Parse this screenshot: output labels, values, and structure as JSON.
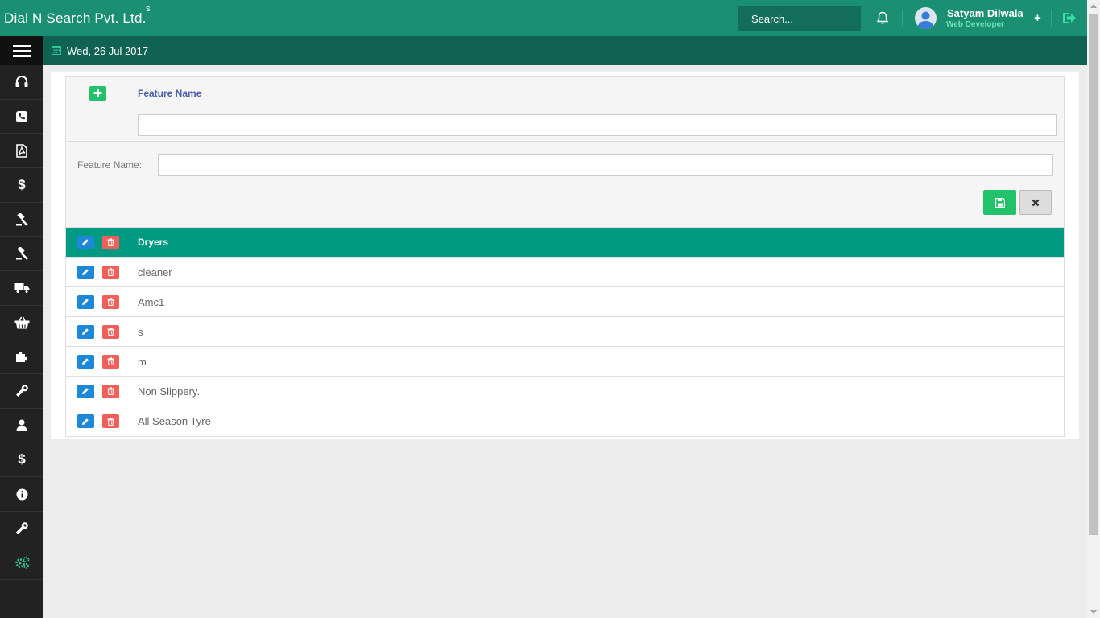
{
  "header": {
    "brand": "Dial N Search Pvt. Ltd.",
    "brand_sup": "s",
    "search_placeholder": "Search...",
    "user_name": "Satyam Dilwala",
    "user_role": "Web Developer",
    "plus_label": "+"
  },
  "subheader": {
    "date": "Wed, 26 Jul 2017"
  },
  "sidebar": {
    "items": [
      {
        "icon": "headset-icon"
      },
      {
        "icon": "phone-icon"
      },
      {
        "icon": "pdf-file-icon"
      },
      {
        "icon": "dollar-icon",
        "glyph": "$"
      },
      {
        "icon": "gavel-icon"
      },
      {
        "icon": "gavel-icon"
      },
      {
        "icon": "truck-icon"
      },
      {
        "icon": "basket-icon"
      },
      {
        "icon": "puzzle-icon"
      },
      {
        "icon": "wrench-icon"
      },
      {
        "icon": "user-icon"
      },
      {
        "icon": "dollar-icon",
        "glyph": "$"
      },
      {
        "icon": "info-icon"
      },
      {
        "icon": "wrench-icon"
      },
      {
        "icon": "gears-icon"
      }
    ]
  },
  "grid": {
    "header_title": "Feature Name",
    "filter_value": "",
    "form": {
      "label": "Feature Name:",
      "value": ""
    },
    "rows": [
      {
        "label": "Dryers",
        "selected": true
      },
      {
        "label": "cleaner"
      },
      {
        "label": "Amc1"
      },
      {
        "label": "s"
      },
      {
        "label": "m"
      },
      {
        "label": "Non Slippery."
      },
      {
        "label": "All Season Tyre"
      }
    ]
  },
  "colors": {
    "header_bg": "#1a8f72",
    "subheader_bg": "#106352",
    "sidebar_bg": "#222222",
    "selected_row": "#009982",
    "add_green": "#21c26a",
    "edit_blue": "#1e88d8",
    "delete_red": "#f0605a"
  }
}
